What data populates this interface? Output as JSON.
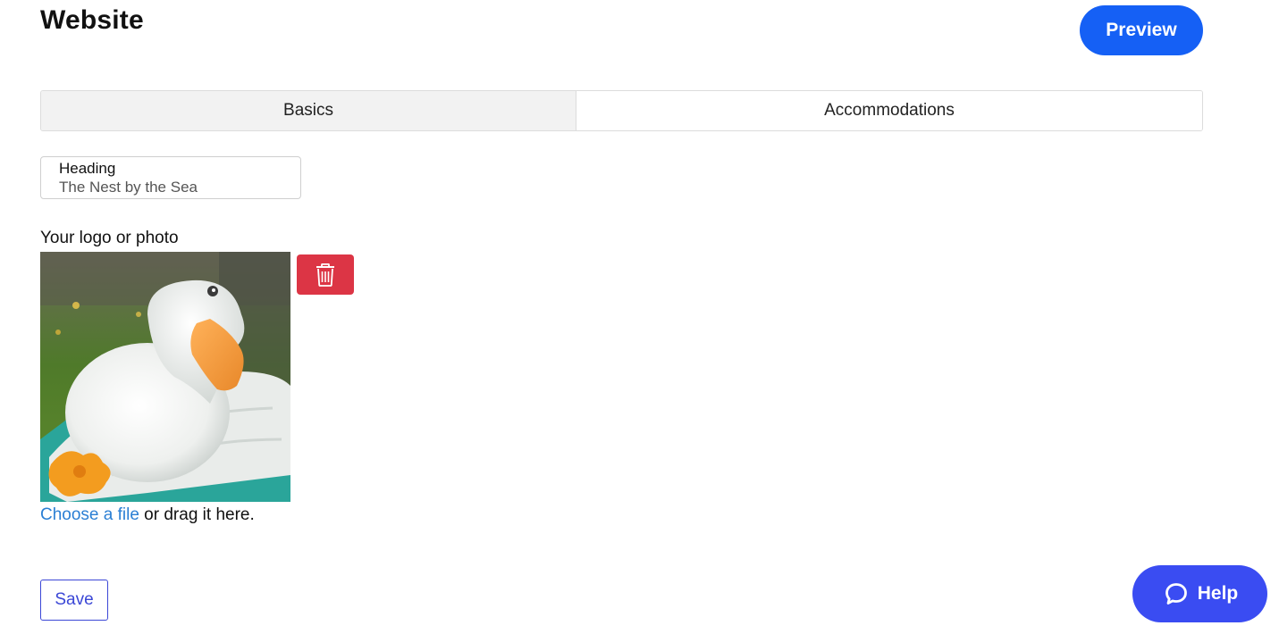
{
  "header": {
    "title": "Website",
    "preview_label": "Preview"
  },
  "tabs": [
    {
      "label": "Basics",
      "active": true
    },
    {
      "label": "Accommodations",
      "active": false
    }
  ],
  "heading_field": {
    "label": "Heading",
    "value": "The Nest by the Sea"
  },
  "logo": {
    "label": "Your logo or photo",
    "image": "photo of a white duck with an orange beak sitting on a white towel",
    "delete_icon": "trash-icon"
  },
  "upload": {
    "link_text": "Choose a file",
    "hint_text": " or drag it here."
  },
  "actions": {
    "save_label": "Save"
  },
  "help": {
    "label": "Help",
    "icon": "chat-bubble-icon"
  },
  "colors": {
    "primary": "#1560f5",
    "help": "#3a4cf2",
    "danger": "#dc3545",
    "link": "#2b7fd4",
    "save_outline": "#3b47d6"
  }
}
